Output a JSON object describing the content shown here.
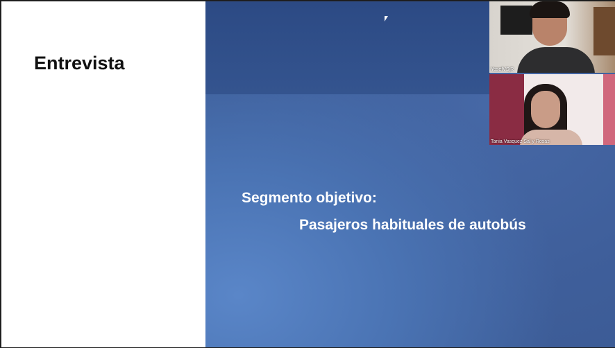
{
  "presentation": {
    "title": "Entrevista",
    "segment_label": "Segmento objetivo:",
    "segment_value": "Pasajeros habituales de autobús"
  },
  "participants": [
    {
      "name": "YosefVSjR"
    },
    {
      "name": "Tania Vasquez Sal y Rosas"
    }
  ],
  "colors": {
    "slide_blue": "#4668a6",
    "left_panel": "#ffffff"
  }
}
